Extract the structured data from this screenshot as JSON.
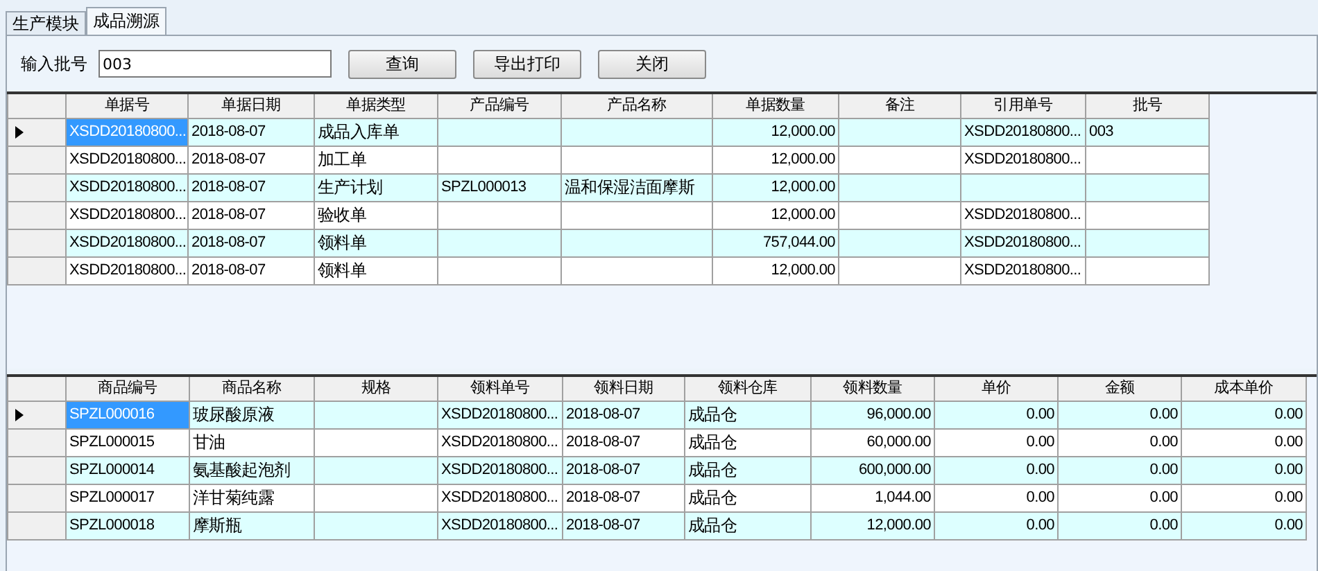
{
  "tabs": [
    {
      "label": "生产模块",
      "selected": false
    },
    {
      "label": "成品溯源",
      "selected": true
    }
  ],
  "toolbar": {
    "label": "输入批号",
    "batch_field": {
      "value": "003"
    },
    "buttons": [
      "查询",
      "导出打印",
      "关闭"
    ]
  },
  "documents_table": {
    "columns": [
      {
        "label": "单据号",
        "kind": "text"
      },
      {
        "label": "单据日期",
        "kind": "text"
      },
      {
        "label": "单据类型",
        "kind": "text"
      },
      {
        "label": "产品编号",
        "kind": "text"
      },
      {
        "label": "产品名称",
        "kind": "text"
      },
      {
        "label": "单据数量",
        "kind": "number"
      },
      {
        "label": "备注",
        "kind": "text"
      },
      {
        "label": "引用单号",
        "kind": "text"
      },
      {
        "label": "批号",
        "kind": "text"
      }
    ],
    "rows": [
      {
        "selected": true,
        "cells": [
          "XSDD20180800...",
          "2018-08-07",
          "成品入库单",
          "",
          "",
          "12,000.00",
          "",
          "XSDD20180800...",
          "003"
        ]
      },
      {
        "selected": false,
        "cells": [
          "XSDD20180800...",
          "2018-08-07",
          "加工单",
          "",
          "",
          "12,000.00",
          "",
          "XSDD20180800...",
          ""
        ]
      },
      {
        "selected": false,
        "cells": [
          "XSDD20180800...",
          "2018-08-07",
          "生产计划",
          "SPZL000013",
          "温和保湿洁面摩斯",
          "12,000.00",
          "",
          "",
          ""
        ]
      },
      {
        "selected": false,
        "cells": [
          "XSDD20180800...",
          "2018-08-07",
          "验收单",
          "",
          "",
          "12,000.00",
          "",
          "XSDD20180800...",
          ""
        ]
      },
      {
        "selected": false,
        "cells": [
          "XSDD20180800...",
          "2018-08-07",
          "领料单",
          "",
          "",
          "757,044.00",
          "",
          "XSDD20180800...",
          ""
        ]
      },
      {
        "selected": false,
        "cells": [
          "XSDD20180800...",
          "2018-08-07",
          "领料单",
          "",
          "",
          "12,000.00",
          "",
          "XSDD20180800...",
          ""
        ]
      }
    ]
  },
  "materials_table": {
    "columns": [
      {
        "label": "商品编号",
        "kind": "text"
      },
      {
        "label": "商品名称",
        "kind": "text"
      },
      {
        "label": "规格",
        "kind": "text"
      },
      {
        "label": "领料单号",
        "kind": "text"
      },
      {
        "label": "领料日期",
        "kind": "text"
      },
      {
        "label": "领料仓库",
        "kind": "text"
      },
      {
        "label": "领料数量",
        "kind": "number"
      },
      {
        "label": "单价",
        "kind": "number"
      },
      {
        "label": "金额",
        "kind": "number"
      },
      {
        "label": "成本单价",
        "kind": "number"
      }
    ],
    "rows": [
      {
        "selected": true,
        "cells": [
          "SPZL000016",
          "玻尿酸原液",
          "",
          "XSDD20180800...",
          "2018-08-07",
          "成品仓",
          "96,000.00",
          "0.00",
          "0.00",
          "0.00"
        ]
      },
      {
        "selected": false,
        "cells": [
          "SPZL000015",
          "甘油",
          "",
          "XSDD20180800...",
          "2018-08-07",
          "成品仓",
          "60,000.00",
          "0.00",
          "0.00",
          "0.00"
        ]
      },
      {
        "selected": false,
        "cells": [
          "SPZL000014",
          "氨基酸起泡剂",
          "",
          "XSDD20180800...",
          "2018-08-07",
          "成品仓",
          "600,000.00",
          "0.00",
          "0.00",
          "0.00"
        ]
      },
      {
        "selected": false,
        "cells": [
          "SPZL000017",
          "洋甘菊纯露",
          "",
          "XSDD20180800...",
          "2018-08-07",
          "成品仓",
          "1,044.00",
          "0.00",
          "0.00",
          "0.00"
        ]
      },
      {
        "selected": false,
        "cells": [
          "SPZL000018",
          "摩斯瓶",
          "",
          "XSDD20180800...",
          "2018-08-07",
          "成品仓",
          "12,000.00",
          "0.00",
          "0.00",
          "0.00"
        ]
      }
    ]
  }
}
